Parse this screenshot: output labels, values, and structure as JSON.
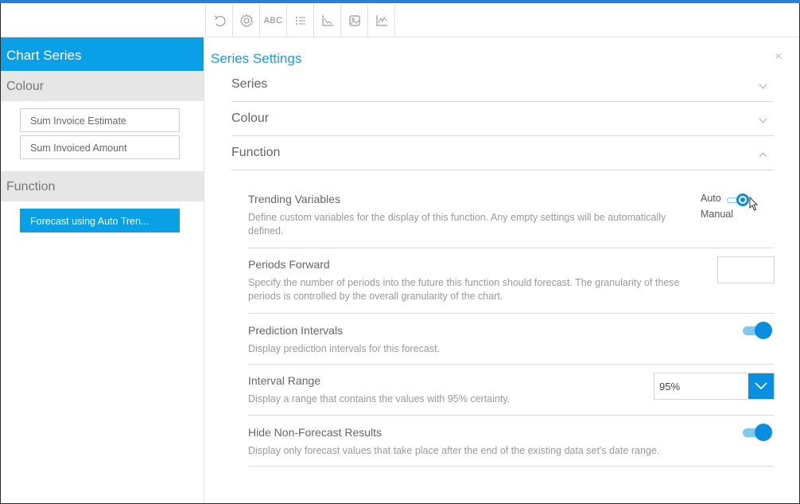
{
  "toolbar": {
    "buttons": [
      {
        "icon": "undo-icon"
      },
      {
        "icon": "gear-icon"
      },
      {
        "icon": "text-abc-icon",
        "label": "ABC"
      },
      {
        "icon": "list-icon"
      },
      {
        "icon": "axis-icon"
      },
      {
        "icon": "image-icon"
      },
      {
        "icon": "line-chart-icon"
      }
    ]
  },
  "left_panel": {
    "header": "Chart Series",
    "colour_section": "Colour",
    "colour_items": [
      "Sum Invoice Estimate",
      "Sum Invoiced Amount"
    ],
    "function_section": "Function",
    "function_items": [
      "Forecast using Auto Tren..."
    ]
  },
  "series_settings": {
    "title": "Series Settings",
    "close_icon": "×",
    "accordions": [
      {
        "label": "Series",
        "state": "collapsed"
      },
      {
        "label": "Colour",
        "state": "collapsed"
      },
      {
        "label": "Function",
        "state": "expanded"
      }
    ],
    "settings": {
      "trending_variables": {
        "title": "Trending Variables",
        "description": "Define custom variables for the display of this function. Any empty settings will be automatically defined.",
        "toggle_left_label": "Auto",
        "toggle_bottom_label": "Manual",
        "toggle_state": "manual"
      },
      "periods_forward": {
        "title": "Periods Forward",
        "description": "Specify the number of periods into the future this function should forecast. The granularity of these periods is controlled by the overall granularity of the chart.",
        "value": ""
      },
      "prediction_intervals": {
        "title": "Prediction Intervals",
        "description": "Display prediction intervals for this forecast.",
        "enabled": true
      },
      "interval_range": {
        "title": "Interval Range",
        "description": "Display a range that contains the values with 95% certainty.",
        "selected": "95%"
      },
      "hide_non_forecast": {
        "title": "Hide Non-Forecast Results",
        "description": "Display only forecast values that take place after the end of the existing data set's date range.",
        "enabled": true
      }
    }
  },
  "colors": {
    "accent": "#0aa0e8",
    "title_blue": "#1e9ae0",
    "toggle_blue": "#0a8fe0"
  }
}
